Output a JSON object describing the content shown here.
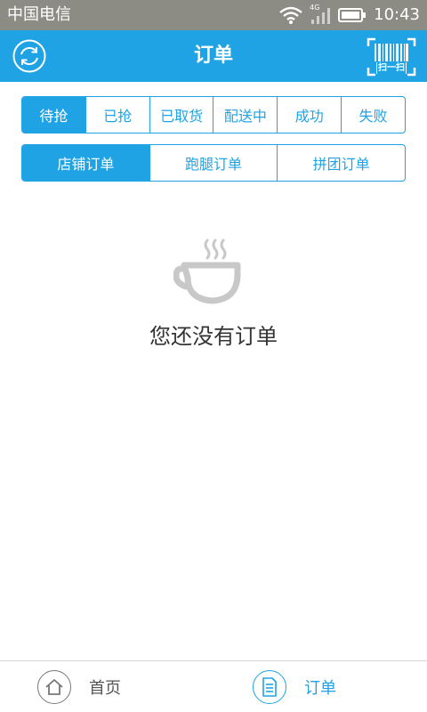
{
  "status_bar": {
    "carrier": "中国电信",
    "network_type": "4G",
    "time": "10:43"
  },
  "header": {
    "title": "订单",
    "scan_label": "扫一扫",
    "refresh_icon": "refresh-icon",
    "scan_icon": "barcode-scan-icon"
  },
  "status_tabs": [
    {
      "label": "待抢",
      "active": true
    },
    {
      "label": "已抢",
      "active": false
    },
    {
      "label": "已取货",
      "active": false
    },
    {
      "label": "配送中",
      "active": false
    },
    {
      "label": "成功",
      "active": false
    },
    {
      "label": "失败",
      "active": false
    }
  ],
  "type_tabs": [
    {
      "label": "店铺订单",
      "active": true
    },
    {
      "label": "跑腿订单",
      "active": false
    },
    {
      "label": "拼团订单",
      "active": false
    }
  ],
  "empty_state": {
    "icon": "coffee-cup-icon",
    "message": "您还没有订单"
  },
  "bottom_nav": {
    "home_label": "首页",
    "orders_label": "订单",
    "active": "orders"
  },
  "colors": {
    "primary": "#1fa3e4",
    "status_bar": "#8c8b84",
    "text": "#333333",
    "icon_gray": "#c8c8c8"
  }
}
